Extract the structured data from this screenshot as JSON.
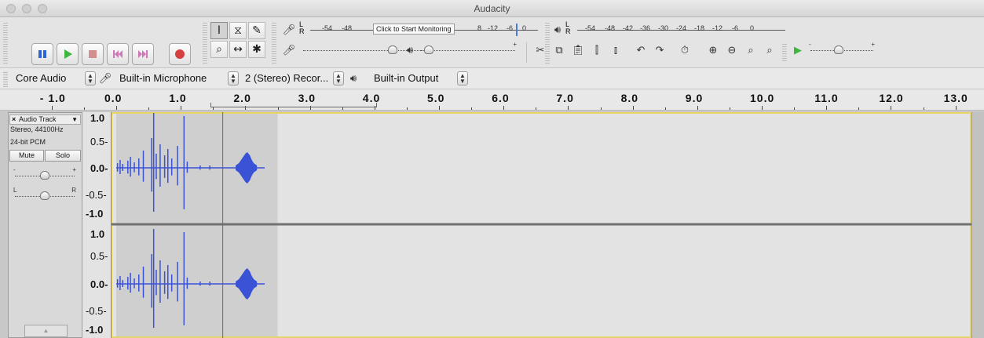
{
  "window": {
    "title": "Audacity"
  },
  "transport": {
    "buttons": [
      {
        "name": "pause",
        "color": "#2a64d6"
      },
      {
        "name": "play",
        "color": "#3fb53f"
      },
      {
        "name": "stop",
        "color": "#d38f8f"
      },
      {
        "name": "skip-to-start",
        "color": "#cf77b6"
      },
      {
        "name": "skip-to-end",
        "color": "#cf77b6"
      },
      {
        "name": "record",
        "color": "#d54040"
      }
    ]
  },
  "tools": {
    "top": [
      "I",
      "⧖",
      "✎"
    ],
    "bottom": [
      "⌕",
      "↔",
      "✱"
    ]
  },
  "record_meter": {
    "channels_l": "L",
    "channels_r": "R",
    "ticks_left": [
      "-54",
      "-48"
    ],
    "monitor_label": "Click to Start Monitoring",
    "ticks_right": [
      "8",
      "-12",
      "-6",
      "0"
    ]
  },
  "play_meter": {
    "channels_l": "L",
    "channels_r": "R",
    "ticks": [
      "-54",
      "-48",
      "-42",
      "-36",
      "-30",
      "-24",
      "-18",
      "-12",
      "-6",
      "0"
    ]
  },
  "sliders": {
    "plus": "+",
    "minus": "-"
  },
  "devices": {
    "host": "Core Audio",
    "recording_device": "Built-in Microphone",
    "channels": "2 (Stereo) Recor...",
    "playback_device": "Built-in Output"
  },
  "ruler": {
    "labels": [
      "- 1.0",
      "0.0",
      "1.0",
      "2.0",
      "3.0",
      "4.0",
      "5.0",
      "6.0",
      "7.0",
      "8.0",
      "9.0",
      "10.0",
      "11.0",
      "12.0",
      "13.0"
    ]
  },
  "track": {
    "name": "Audio Track",
    "close": "×",
    "menu_arrow": "▼",
    "format": "Stereo, 44100Hz",
    "bit_depth": "24-bit PCM",
    "mute_label": "Mute",
    "solo_label": "Solo",
    "gain": {
      "minus": "-",
      "plus": "+",
      "level": 0.5
    },
    "pan": {
      "left": "L",
      "right": "R",
      "level": 0.5
    },
    "collapse_arrow": "▲",
    "scale_ch1": [
      "1.0",
      "0.5-",
      "0.0-",
      "-0.5-",
      "-1.0"
    ],
    "scale_ch2": [
      "1.0",
      "0.5-",
      "0.0-",
      "-0.5-",
      "-1.0"
    ],
    "wave_color": "#3a52d6",
    "selection": {
      "start_s": 0.0,
      "end_s": 2.5,
      "cursor_s": 1.65
    }
  }
}
